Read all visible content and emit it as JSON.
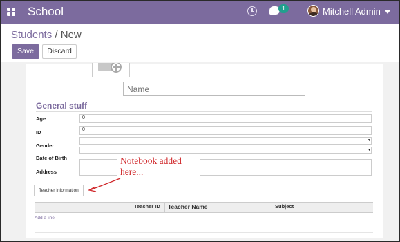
{
  "navbar": {
    "app_title": "School",
    "chat_count": "1",
    "user_name": "Mitchell Admin"
  },
  "breadcrumb": {
    "parent": "Students",
    "separator": "/",
    "current": "New"
  },
  "buttons": {
    "save": "Save",
    "discard": "Discard"
  },
  "form": {
    "name_placeholder": "Name",
    "group_title": "General stuff",
    "fields": {
      "age": {
        "label": "Age",
        "value": "0"
      },
      "id": {
        "label": "ID",
        "value": "0"
      },
      "gender": {
        "label": "Gender",
        "value": ""
      },
      "dob": {
        "label": "Date of Birth",
        "value": ""
      },
      "address": {
        "label": "Address",
        "value": ""
      }
    }
  },
  "annotation": {
    "line1": "Notebook  added",
    "line2": "here...",
    "color": "#d0292c"
  },
  "notebook": {
    "tab_label": "Teacher Information",
    "columns": [
      "Teacher ID",
      "Teacher Name",
      "Subject"
    ],
    "add_line": "Add a line"
  },
  "theme": {
    "brand": "#7c6b9e",
    "badge": "#21a08e"
  }
}
